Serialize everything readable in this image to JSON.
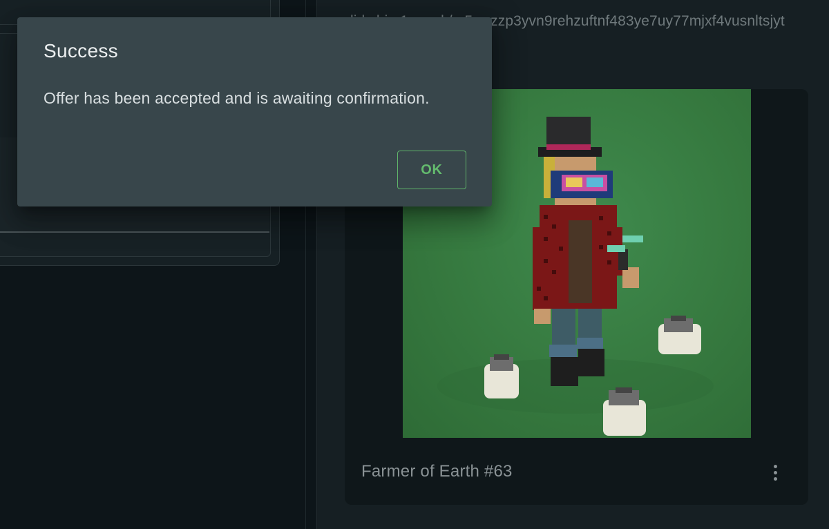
{
  "background": {
    "address_text": "did:chia:1...ersk/...5cwzzp3yvn9rehzuftnf483ye7uy77mjxf4vusnltsjyt",
    "nft_card": {
      "title": "Farmer of Earth #63",
      "more_icon": "more-vertical-icon"
    }
  },
  "dialog": {
    "title": "Success",
    "message": "Offer has been accepted and is awaiting confirmation.",
    "ok_label": "OK"
  },
  "colors": {
    "accent": "#5fb46a",
    "dialog_bg": "#38464b",
    "page_bg": "#0d1519"
  }
}
